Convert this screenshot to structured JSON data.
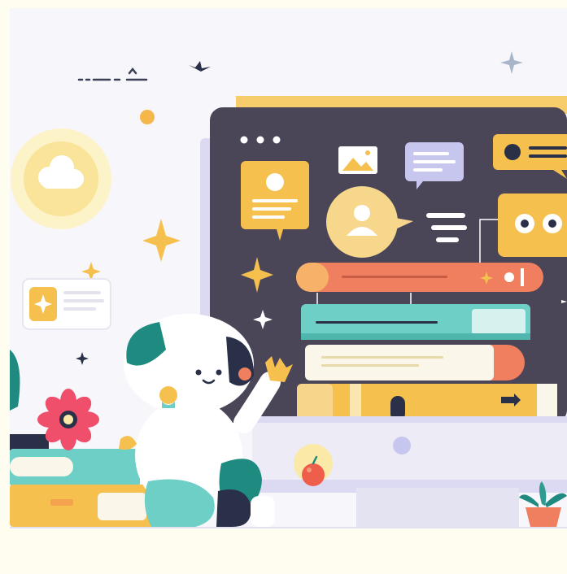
{
  "scene": {
    "subject": "",
    "colors": {
      "page_bg": "#fffdf0",
      "scene_bg": "#f6f6fb",
      "board": "#4a4658",
      "yellow": "#f5c04e",
      "coral": "#ef7f5e",
      "teal": "#6dcfc6",
      "dark_teal": "#1f8a80",
      "lavender": "#c7c6ef",
      "navy": "#2a3048"
    }
  }
}
